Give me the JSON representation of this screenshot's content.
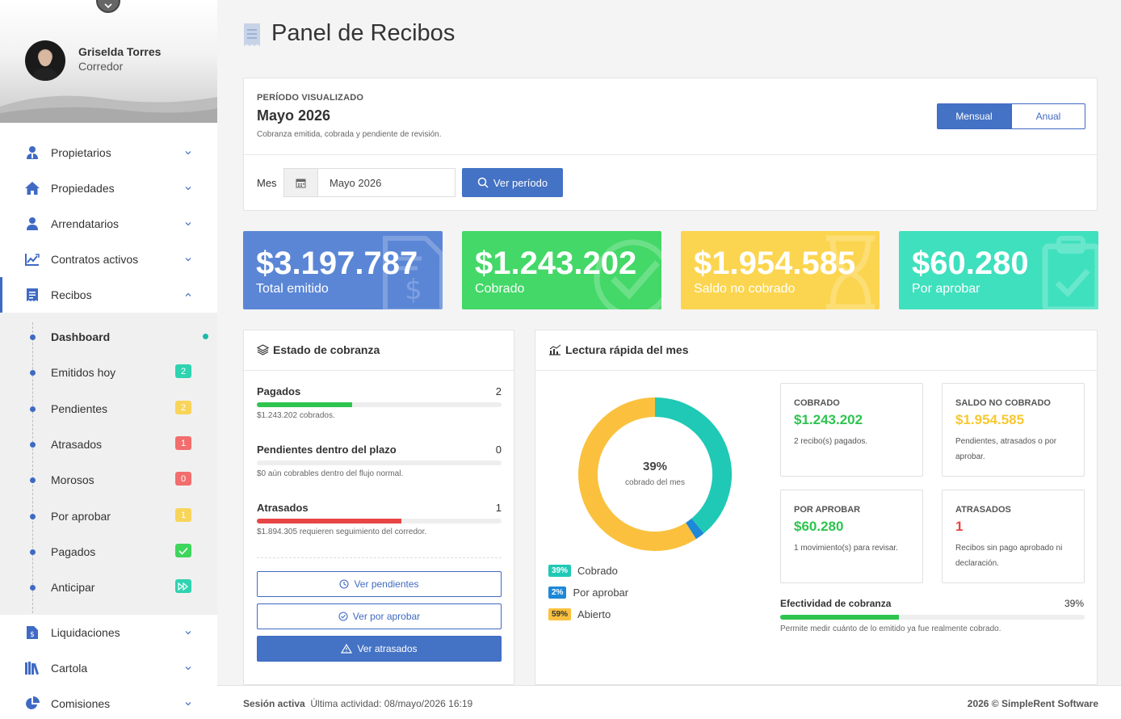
{
  "user": {
    "name": "Griselda Torres",
    "role": "Corredor"
  },
  "nav": {
    "items": [
      {
        "label": "Propietarios",
        "icon": "owner-icon"
      },
      {
        "label": "Propiedades",
        "icon": "house-icon"
      },
      {
        "label": "Arrendatarios",
        "icon": "user-icon"
      },
      {
        "label": "Contratos activos",
        "icon": "contract-icon"
      },
      {
        "label": "Recibos",
        "icon": "receipt-icon"
      },
      {
        "label": "Liquidaciones",
        "icon": "invoice-icon"
      },
      {
        "label": "Cartola",
        "icon": "books-icon"
      },
      {
        "label": "Comisiones",
        "icon": "pie-icon"
      }
    ],
    "sub": [
      {
        "label": "Dashboard",
        "badge": ""
      },
      {
        "label": "Emitidos hoy",
        "badge": "2",
        "badge_color": "#2ed3b0"
      },
      {
        "label": "Pendientes",
        "badge": "2",
        "badge_color": "#f8d55a"
      },
      {
        "label": "Atrasados",
        "badge": "1",
        "badge_color": "#f26d6d"
      },
      {
        "label": "Morosos",
        "badge": "0",
        "badge_color": "#f26d6d"
      },
      {
        "label": "Por aprobar",
        "badge": "1",
        "badge_color": "#f8d55a"
      },
      {
        "label": "Pagados",
        "badge": "check",
        "badge_color": "#3ed65c"
      },
      {
        "label": "Anticipar",
        "badge": "ff",
        "badge_color": "#2ed3b0"
      }
    ]
  },
  "page": {
    "title": "Panel de Recibos"
  },
  "period": {
    "label": "PERÍODO VISUALIZADO",
    "value": "Mayo 2026",
    "description": "Cobranza emitida, cobrada y pendiente de revisión.",
    "toggle_monthly": "Mensual",
    "toggle_yearly": "Anual",
    "month_label": "Mes",
    "month_value": "Mayo 2026",
    "view_button": "Ver período"
  },
  "stats": [
    {
      "value": "$3.197.787",
      "label": "Total emitido",
      "color": "#5b86d6"
    },
    {
      "value": "$1.243.202",
      "label": "Cobrado",
      "color": "#43d867"
    },
    {
      "value": "$1.954.585",
      "label": "Saldo no cobrado",
      "color": "#fbd54f"
    },
    {
      "value": "$60.280",
      "label": "Por aprobar",
      "color": "#3fe0be"
    }
  ],
  "estado": {
    "title": "Estado de cobranza",
    "rows": [
      {
        "title": "Pagados",
        "count": "2",
        "desc": "$1.243.202 cobrados.",
        "fill": 0.39,
        "color": "#2ec44f"
      },
      {
        "title": "Pendientes dentro del plazo",
        "count": "0",
        "desc": "$0 aún cobrables dentro del flujo normal.",
        "fill": 0,
        "color": "#f5b935"
      },
      {
        "title": "Atrasados",
        "count": "1",
        "desc": "$1.894.305 requieren seguimiento del corredor.",
        "fill": 0.59,
        "color": "#e84545"
      }
    ],
    "btn_pendientes": "Ver pendientes",
    "btn_por_aprobar": "Ver por aprobar",
    "btn_atrasados": "Ver atrasados"
  },
  "lectura": {
    "title": "Lectura rápida del mes",
    "donut_pct": "39%",
    "donut_caption": "cobrado del mes",
    "legend": [
      {
        "badge": "39%",
        "label": "Cobrado",
        "color": "#1fc9b5"
      },
      {
        "badge": "2%",
        "label": "Por aprobar",
        "color": "#1e88d8"
      },
      {
        "badge": "59%",
        "label": "Abierto",
        "color": "#fbc13e"
      }
    ],
    "cards": [
      {
        "title": "COBRADO",
        "value": "$1.243.202",
        "desc": "2 recibo(s) pagados.",
        "color": "#2ec44f"
      },
      {
        "title": "SALDO NO COBRADO",
        "value": "$1.954.585",
        "desc": "Pendientes, atrasados o por aprobar.",
        "color": "#f8c830"
      },
      {
        "title": "POR APROBAR",
        "value": "$60.280",
        "desc": "1 movimiento(s) para revisar.",
        "color": "#2ec44f"
      },
      {
        "title": "ATRASADOS",
        "value": "1",
        "desc": "Recibos sin pago aprobado ni declaración.",
        "color": "#e84545"
      }
    ],
    "efectividad_title": "Efectividad de cobranza",
    "efectividad_pct": "39%",
    "efectividad_value": 0.39,
    "efectividad_desc": "Permite medir cuánto de lo emitido ya fue realmente cobrado."
  },
  "chart_data": {
    "type": "pie",
    "categories": [
      "Cobrado",
      "Por aprobar",
      "Abierto"
    ],
    "values": [
      39,
      2,
      59
    ]
  },
  "footer": {
    "session_label": "Sesión activa",
    "last_activity": "Última actividad: 08/mayo/2026 16:19",
    "copyright": "2026 © SimpleRent Software"
  }
}
